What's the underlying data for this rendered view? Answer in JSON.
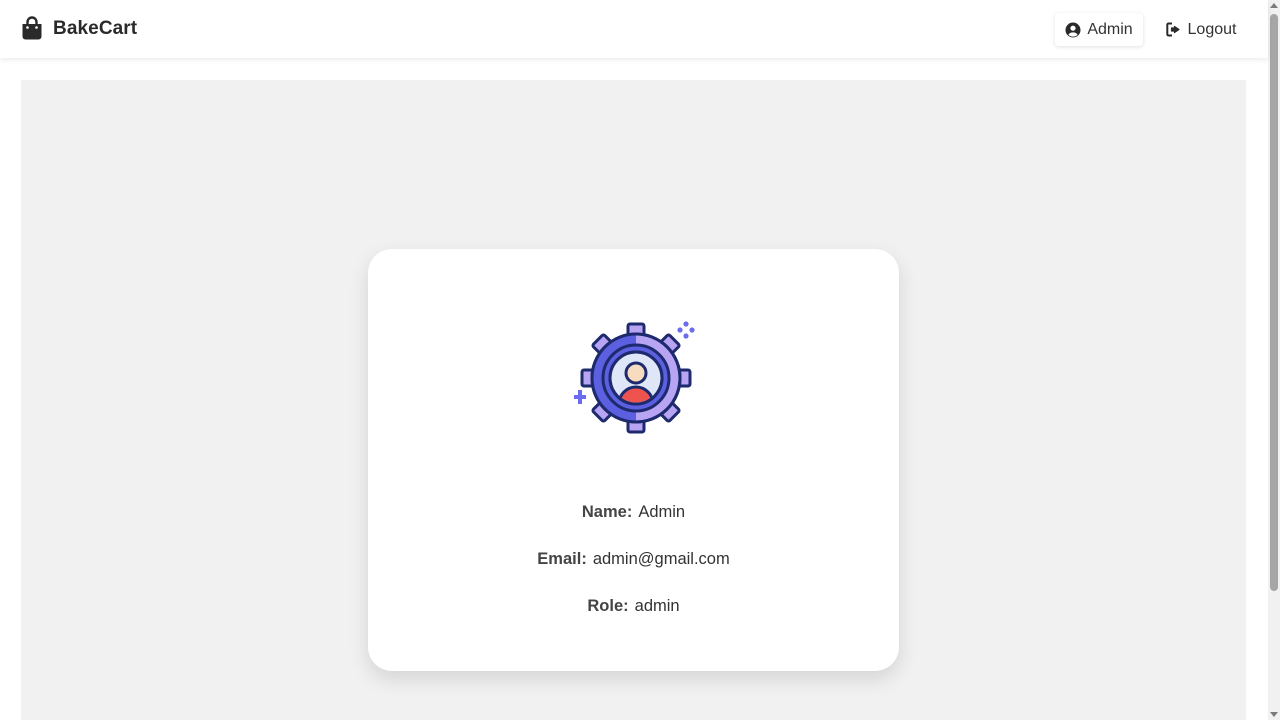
{
  "app": {
    "brand": "BakeCart"
  },
  "nav": {
    "user_label": "Admin",
    "logout_label": "Logout"
  },
  "profile": {
    "name_label": "Name:",
    "name_value": "Admin",
    "email_label": "Email:",
    "email_value": "admin@gmail.com",
    "role_label": "Role:",
    "role_value": "admin"
  },
  "icons": {
    "brand": "shopping-bag-icon",
    "user": "user-circle-icon",
    "logout": "sign-out-icon",
    "avatar": "user-settings-gear-icon"
  },
  "colors": {
    "panel_bg": "#f1f1f1",
    "card_bg": "#ffffff",
    "gear_primary": "#5b5fe0",
    "gear_secondary": "#b7a4f3",
    "gear_outline": "#1e2a6e",
    "person_body": "#ef5350",
    "person_head": "#f8dcbf"
  }
}
